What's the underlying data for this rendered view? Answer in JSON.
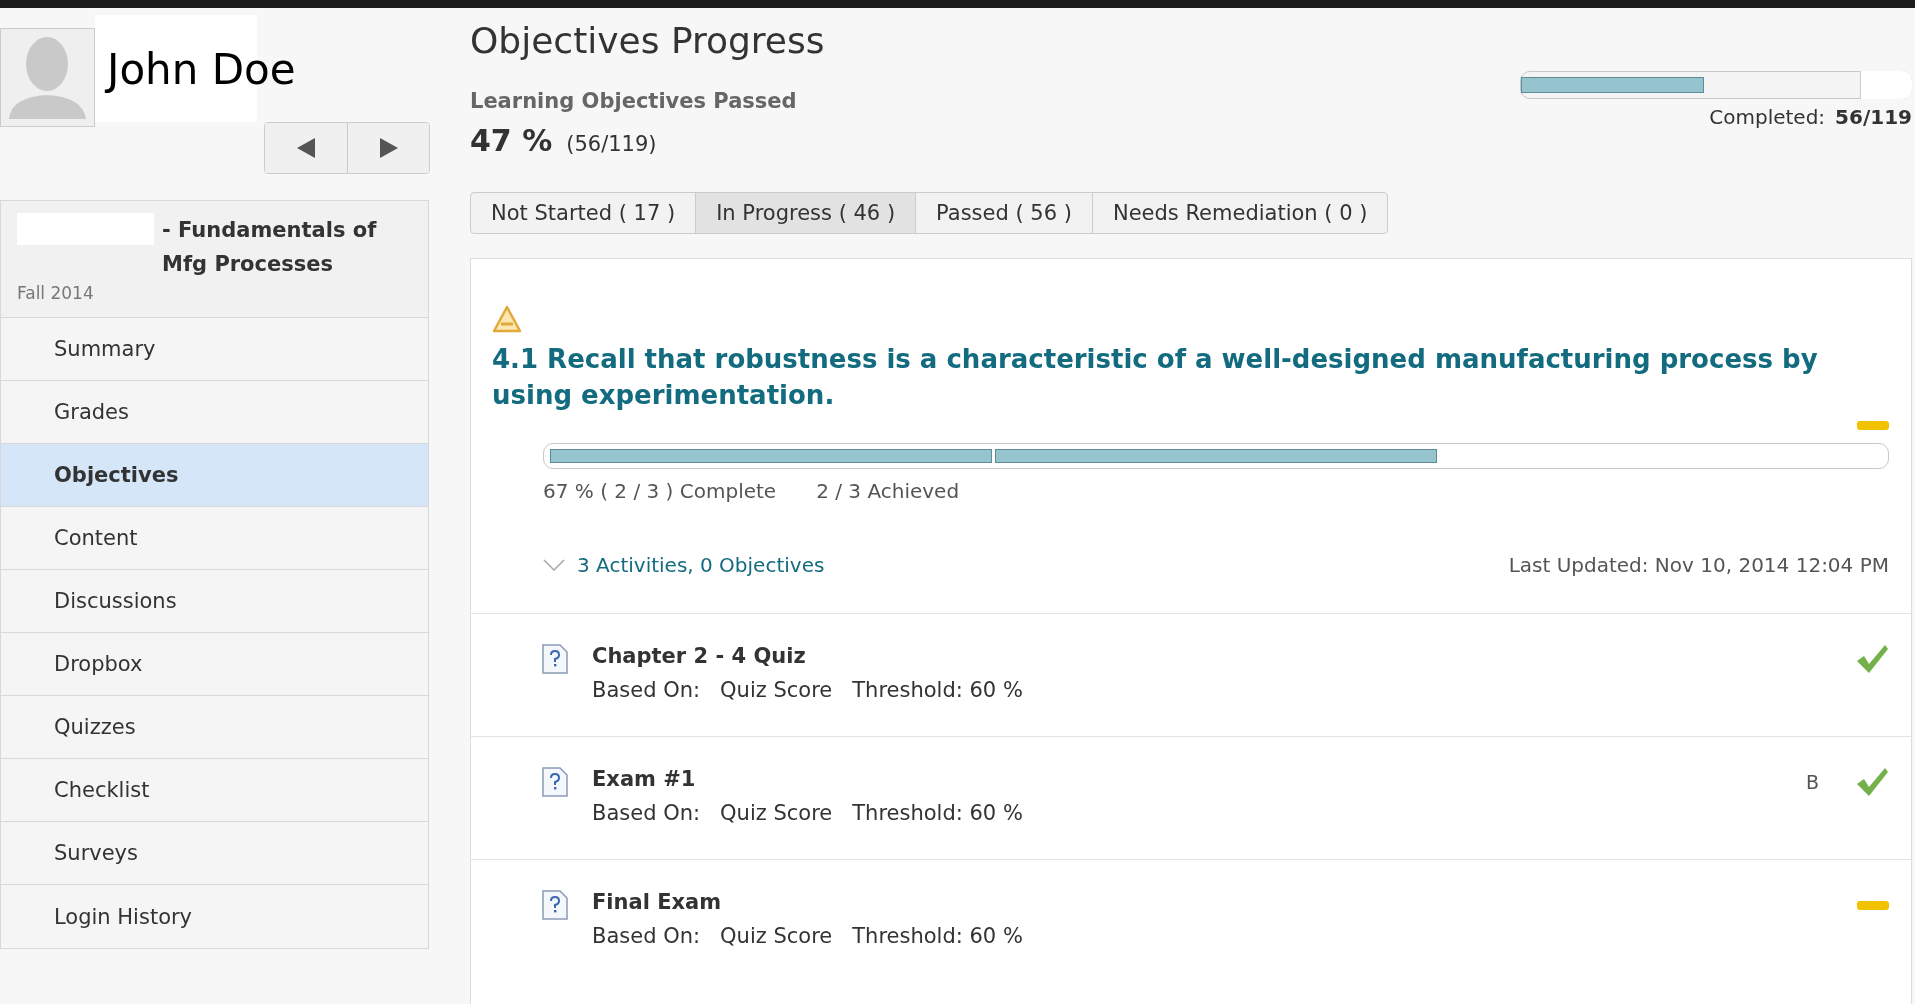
{
  "user": {
    "name": "John Doe"
  },
  "course": {
    "title": "- Fundamentals of Mfg Processes",
    "term": "Fall 2014"
  },
  "sidebar": {
    "items": [
      {
        "label": "Summary",
        "selected": false
      },
      {
        "label": "Grades",
        "selected": false
      },
      {
        "label": "Objectives",
        "selected": true
      },
      {
        "label": "Content",
        "selected": false
      },
      {
        "label": "Discussions",
        "selected": false
      },
      {
        "label": "Dropbox",
        "selected": false
      },
      {
        "label": "Quizzes",
        "selected": false
      },
      {
        "label": "Checklist",
        "selected": false
      },
      {
        "label": "Surveys",
        "selected": false
      },
      {
        "label": "Login History",
        "selected": false
      }
    ]
  },
  "page": {
    "title": "Objectives Progress",
    "summary_label": "Learning Objectives Passed",
    "percent": "47 %",
    "fraction": "(56/119)",
    "overall": {
      "level": 0.47,
      "completed_label": "Completed:",
      "completed_value": "56/119"
    }
  },
  "tabs": [
    {
      "label": "Not Started ( 17 )",
      "selected": false
    },
    {
      "label": "In Progress ( 46 )",
      "selected": true
    },
    {
      "label": "Passed ( 56 )",
      "selected": false
    },
    {
      "label": "Needs Remediation ( 0 )",
      "selected": false
    }
  ],
  "objective": {
    "passed": false,
    "title": "4.1 Recall that robustness is a characteristic of a well-designed manufacturing process by using experimentation.",
    "segments": [
      {
        "achieved": true
      },
      {
        "achieved": true
      },
      {
        "achieved": false
      }
    ],
    "complete_text": "67 % ( 2 / 3 ) Complete",
    "achieved_text": "2 / 3 Achieved",
    "expanded": true,
    "toggle_label": "3 Activities, 0 Objectives",
    "last_updated": "Last Updated: Nov 10, 2014 12:04 PM",
    "activities": [
      {
        "title": "Chapter 2 - 4 Quiz",
        "based_on_label": "Based On:",
        "based_on": "Quiz Score",
        "threshold": "Threshold: 60 %",
        "passed": true
      },
      {
        "title": "Exam #1",
        "based_on_label": "Based On:",
        "based_on": "Quiz Score",
        "threshold": "Threshold: 60 %",
        "grade": "B",
        "passed": true
      },
      {
        "title": "Final Exam",
        "based_on_label": "Based On:",
        "based_on": "Quiz Score",
        "threshold": "Threshold: 60 %",
        "passed": false
      }
    ]
  }
}
